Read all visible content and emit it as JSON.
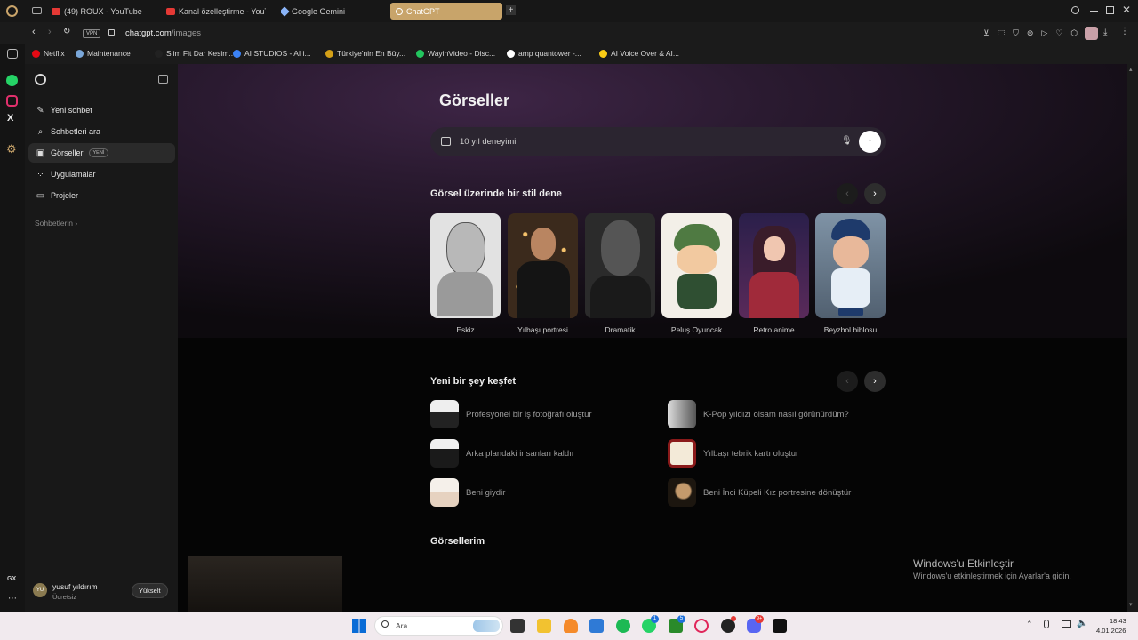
{
  "tabs": [
    {
      "label": "(49) ROUX - YouTube",
      "color": "#e53935"
    },
    {
      "label": "Kanal özelleştirme - YouTube",
      "color": "#e53935"
    },
    {
      "label": "Google Gemini",
      "color": "#8ab4f8"
    },
    {
      "label": "ChatGPT",
      "color": "#ffffff"
    }
  ],
  "address": {
    "vpn": "VPN",
    "url_host": "chatgpt.com",
    "url_path": "/images"
  },
  "bookmarks": [
    {
      "label": "Netflix",
      "color": "#e50914"
    },
    {
      "label": "Maintenance",
      "color": "#7aa7d9"
    },
    {
      "label": "Slim Fit Dar Kesim...",
      "color": "#222"
    },
    {
      "label": "AI STUDIOS - AI i...",
      "color": "#3b82f6"
    },
    {
      "label": "Türkiye'nin En Büy...",
      "color": "#d4a017"
    },
    {
      "label": "WayinVideo - Disc...",
      "color": "#22c55e"
    },
    {
      "label": "amp quantower -...",
      "color": "#ffffff"
    },
    {
      "label": "AI Voice Over & AI...",
      "color": "#facc15"
    }
  ],
  "sidebar": {
    "items": [
      {
        "label": "Yeni sohbet",
        "icon": "compose-icon"
      },
      {
        "label": "Sohbetleri ara",
        "icon": "search-icon"
      },
      {
        "label": "Görseller",
        "icon": "images-icon",
        "badge": "YENİ"
      },
      {
        "label": "Uygulamalar",
        "icon": "apps-icon"
      },
      {
        "label": "Projeler",
        "icon": "folder-icon"
      }
    ],
    "section": "Sohbetlerin",
    "user": {
      "initials": "YU",
      "name": "yusuf yıldırım",
      "plan": "Ücretsiz",
      "upgrade": "Yükselt"
    }
  },
  "main": {
    "title": "Görseller",
    "prompt_value": "10 yıl deneyimi",
    "styles_heading": "Görsel üzerinde bir stil dene",
    "styles": [
      {
        "label": "Eskiz",
        "bg": "#d9d9d9"
      },
      {
        "label": "Yılbaşı portresi",
        "bg": "#3a2a1a"
      },
      {
        "label": "Dramatik",
        "bg": "#2a2a2a"
      },
      {
        "label": "Peluş Oyuncak",
        "bg": "#f3efe8"
      },
      {
        "label": "Retro anime",
        "bg": "#3a2250"
      },
      {
        "label": "Beyzbol biblosu",
        "bg": "#8a9aa8"
      }
    ],
    "discover_heading": "Yeni bir şey keşfet",
    "suggestions": [
      {
        "label": "Profesyonel bir iş fotoğrafı oluştur"
      },
      {
        "label": "K-Pop yıldızı olsam nasıl görünürdüm?"
      },
      {
        "label": "Arka plandaki insanları kaldır"
      },
      {
        "label": "Yılbaşı tebrik kartı oluştur"
      },
      {
        "label": "Beni giydir"
      },
      {
        "label": "Beni İnci Küpeli Kız portresine dönüştür"
      }
    ],
    "my_images_heading": "Görsellerim"
  },
  "watermark": {
    "title": "Windows'u Etkinleştir",
    "subtitle": "Windows'u etkinleştirmek için Ayarlar'a gidin."
  },
  "taskbar": {
    "search": "Ara",
    "time": "18:43",
    "date": "4.01.2026",
    "badges": [
      "1",
      "5",
      "9+"
    ],
    "gx": "GX"
  }
}
